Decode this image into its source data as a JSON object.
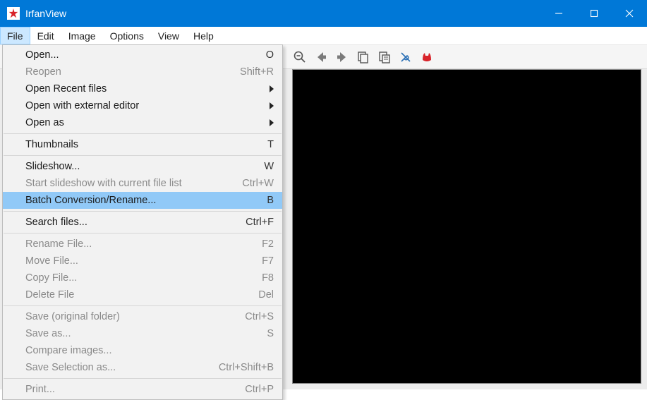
{
  "window": {
    "title": "IrfanView"
  },
  "menubar": {
    "items": [
      "File",
      "Edit",
      "Image",
      "Options",
      "View",
      "Help"
    ],
    "open_index": 0
  },
  "toolbar": {
    "icons": [
      "zoom-out",
      "arrow-left",
      "arrow-right",
      "copy",
      "paste",
      "tools",
      "cat"
    ]
  },
  "file_menu": {
    "groups": [
      [
        {
          "label": "Open...",
          "accel": "O",
          "enabled": true
        },
        {
          "label": "Reopen",
          "accel": "Shift+R",
          "enabled": false
        },
        {
          "label": "Open Recent files",
          "submenu": true,
          "enabled": true
        },
        {
          "label": "Open with external editor",
          "submenu": true,
          "enabled": true
        },
        {
          "label": "Open as",
          "submenu": true,
          "enabled": true
        }
      ],
      [
        {
          "label": "Thumbnails",
          "accel": "T",
          "enabled": true
        }
      ],
      [
        {
          "label": "Slideshow...",
          "accel": "W",
          "enabled": true
        },
        {
          "label": "Start slideshow with current file list",
          "accel": "Ctrl+W",
          "enabled": false
        },
        {
          "label": "Batch Conversion/Rename...",
          "accel": "B",
          "enabled": true,
          "highlighted": true
        }
      ],
      [
        {
          "label": "Search files...",
          "accel": "Ctrl+F",
          "enabled": true
        }
      ],
      [
        {
          "label": "Rename File...",
          "accel": "F2",
          "enabled": false
        },
        {
          "label": "Move File...",
          "accel": "F7",
          "enabled": false
        },
        {
          "label": "Copy File...",
          "accel": "F8",
          "enabled": false
        },
        {
          "label": "Delete File",
          "accel": "Del",
          "enabled": false
        }
      ],
      [
        {
          "label": "Save (original folder)",
          "accel": "Ctrl+S",
          "enabled": false
        },
        {
          "label": "Save as...",
          "accel": "S",
          "enabled": false
        },
        {
          "label": "Compare images...",
          "enabled": false
        },
        {
          "label": "Save Selection as...",
          "accel": "Ctrl+Shift+B",
          "enabled": false
        }
      ],
      [
        {
          "label": "Print...",
          "accel": "Ctrl+P",
          "enabled": false
        }
      ]
    ]
  }
}
